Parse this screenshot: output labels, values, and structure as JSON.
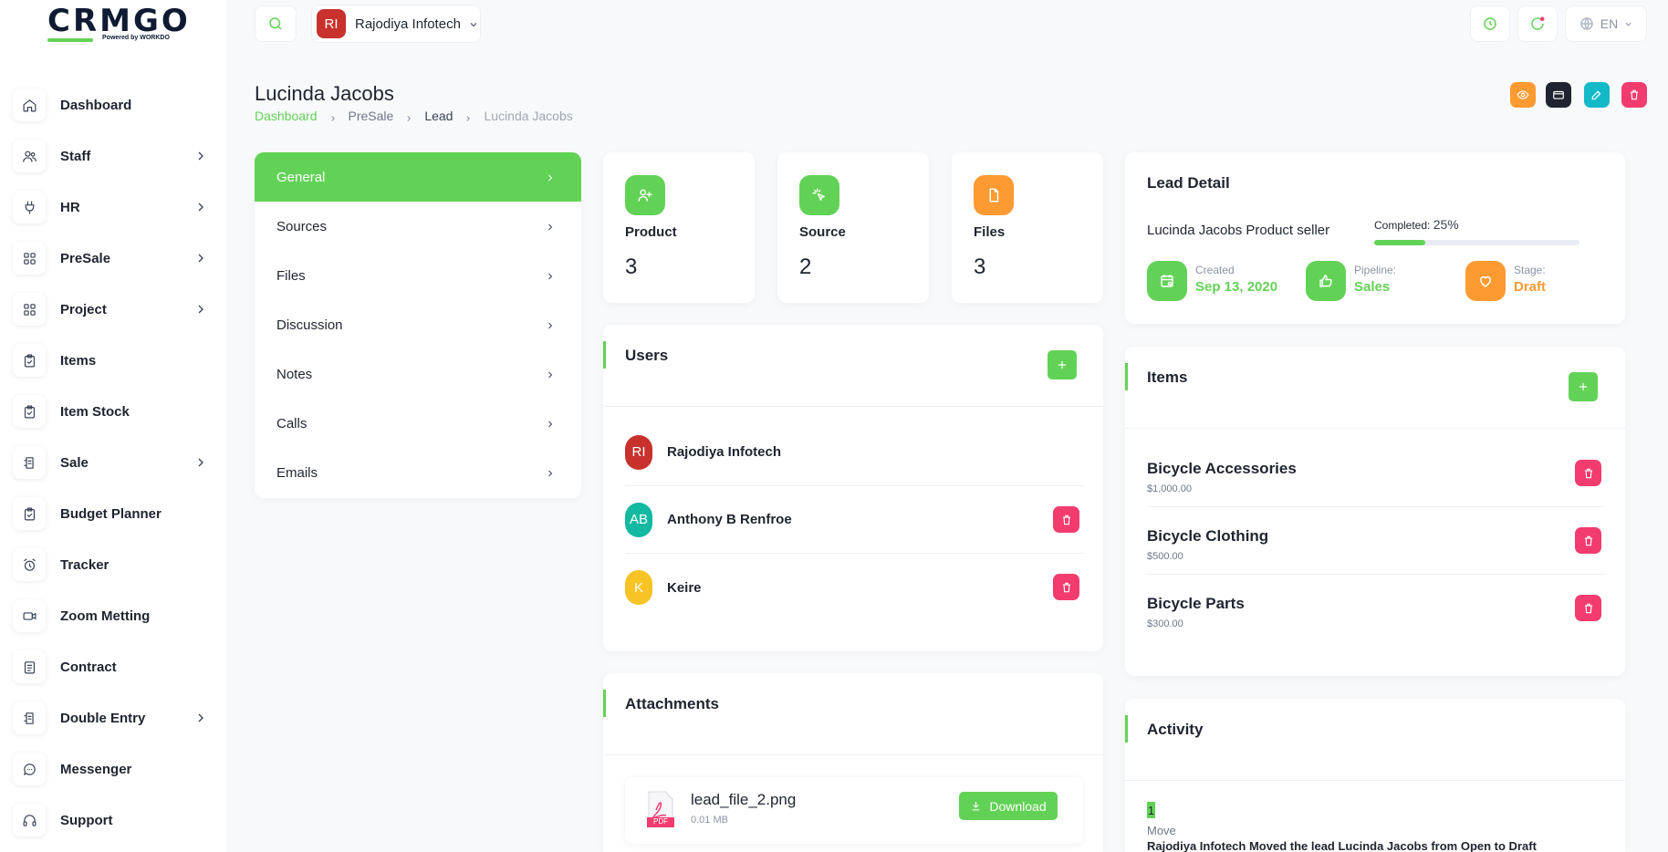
{
  "brand": {
    "logo_text": "CRMGO",
    "tagline": "Powered by WORKDO"
  },
  "sidebar": {
    "items": [
      {
        "label": "Dashboard",
        "icon": "home-icon",
        "has_children": false
      },
      {
        "label": "Staff",
        "icon": "users-icon",
        "has_children": true
      },
      {
        "label": "HR",
        "icon": "plug-icon",
        "has_children": true
      },
      {
        "label": "PreSale",
        "icon": "grid-icon",
        "has_children": true
      },
      {
        "label": "Project",
        "icon": "grid-icon",
        "has_children": true
      },
      {
        "label": "Items",
        "icon": "clipboard-icon",
        "has_children": false
      },
      {
        "label": "Item Stock",
        "icon": "clipboard-icon",
        "has_children": false
      },
      {
        "label": "Sale",
        "icon": "receipt-icon",
        "has_children": true
      },
      {
        "label": "Budget Planner",
        "icon": "clipboard-icon",
        "has_children": false
      },
      {
        "label": "Tracker",
        "icon": "alarm-icon",
        "has_children": false
      },
      {
        "label": "Zoom Metting",
        "icon": "video-icon",
        "has_children": false
      },
      {
        "label": "Contract",
        "icon": "document-icon",
        "has_children": false
      },
      {
        "label": "Double Entry",
        "icon": "receipt-icon",
        "has_children": true
      },
      {
        "label": "Messenger",
        "icon": "chat-icon",
        "has_children": false
      },
      {
        "label": "Support",
        "icon": "headset-icon",
        "has_children": false
      }
    ]
  },
  "topbar": {
    "workspace_initials": "RI",
    "workspace_name": "Rajodiya Infotech",
    "language": "EN"
  },
  "page": {
    "title": "Lucinda Jacobs",
    "breadcrumb": [
      "Dashboard",
      "PreSale",
      "Lead",
      "Lucinda Jacobs"
    ]
  },
  "tabs": [
    {
      "label": "General",
      "active": true
    },
    {
      "label": "Sources",
      "active": false
    },
    {
      "label": "Files",
      "active": false
    },
    {
      "label": "Discussion",
      "active": false
    },
    {
      "label": "Notes",
      "active": false
    },
    {
      "label": "Calls",
      "active": false
    },
    {
      "label": "Emails",
      "active": false
    }
  ],
  "stats": [
    {
      "label": "Product",
      "value": "3",
      "color": "#62d256",
      "icon": "user-plus-icon"
    },
    {
      "label": "Source",
      "value": "2",
      "color": "#62d256",
      "icon": "pointer-click-icon"
    },
    {
      "label": "Files",
      "value": "3",
      "color": "#fd9a32",
      "icon": "file-icon"
    }
  ],
  "users": {
    "title": "Users",
    "list": [
      {
        "initials": "RI",
        "name": "Rajodiya Infotech",
        "color": "#c8312c",
        "deletable": false
      },
      {
        "initials": "AB",
        "name": "Anthony B Renfroe",
        "color": "#13b9a0",
        "deletable": true
      },
      {
        "initials": "K",
        "name": "Keire",
        "color": "#f7c325",
        "deletable": true
      }
    ]
  },
  "attachments": {
    "title": "Attachments",
    "files": [
      {
        "name": "lead_file_2.png",
        "size": "0.01 MB",
        "type_badge": "PDF",
        "download_label": "Download"
      }
    ]
  },
  "lead_detail": {
    "title": "Lead Detail",
    "description": "Lucinda Jacobs Product seller",
    "completed_label": "Completed:",
    "completed_pct": "25%",
    "progress": 0.25,
    "created_label": "Created",
    "created_value": "Sep 13, 2020",
    "pipeline_label": "Pipeline:",
    "pipeline_value": "Sales",
    "stage_label": "Stage:",
    "stage_value": "Draft"
  },
  "items": {
    "title": "Items",
    "list": [
      {
        "name": "Bicycle Accessories",
        "price": "$1,000.00"
      },
      {
        "name": "Bicycle Clothing",
        "price": "$500.00"
      },
      {
        "name": "Bicycle Parts",
        "price": "$300.00"
      }
    ]
  },
  "activity": {
    "title": "Activity",
    "entries": [
      {
        "index": "1",
        "type": "Move",
        "text": "Rajodiya Infotech Moved the lead Lucinda Jacobs from Open to Draft"
      }
    ]
  },
  "colors": {
    "accent": "#62d256",
    "orange": "#fd9a32",
    "danger": "#f23c6f",
    "dark": "#1f2430",
    "teal": "#13b9c7"
  }
}
